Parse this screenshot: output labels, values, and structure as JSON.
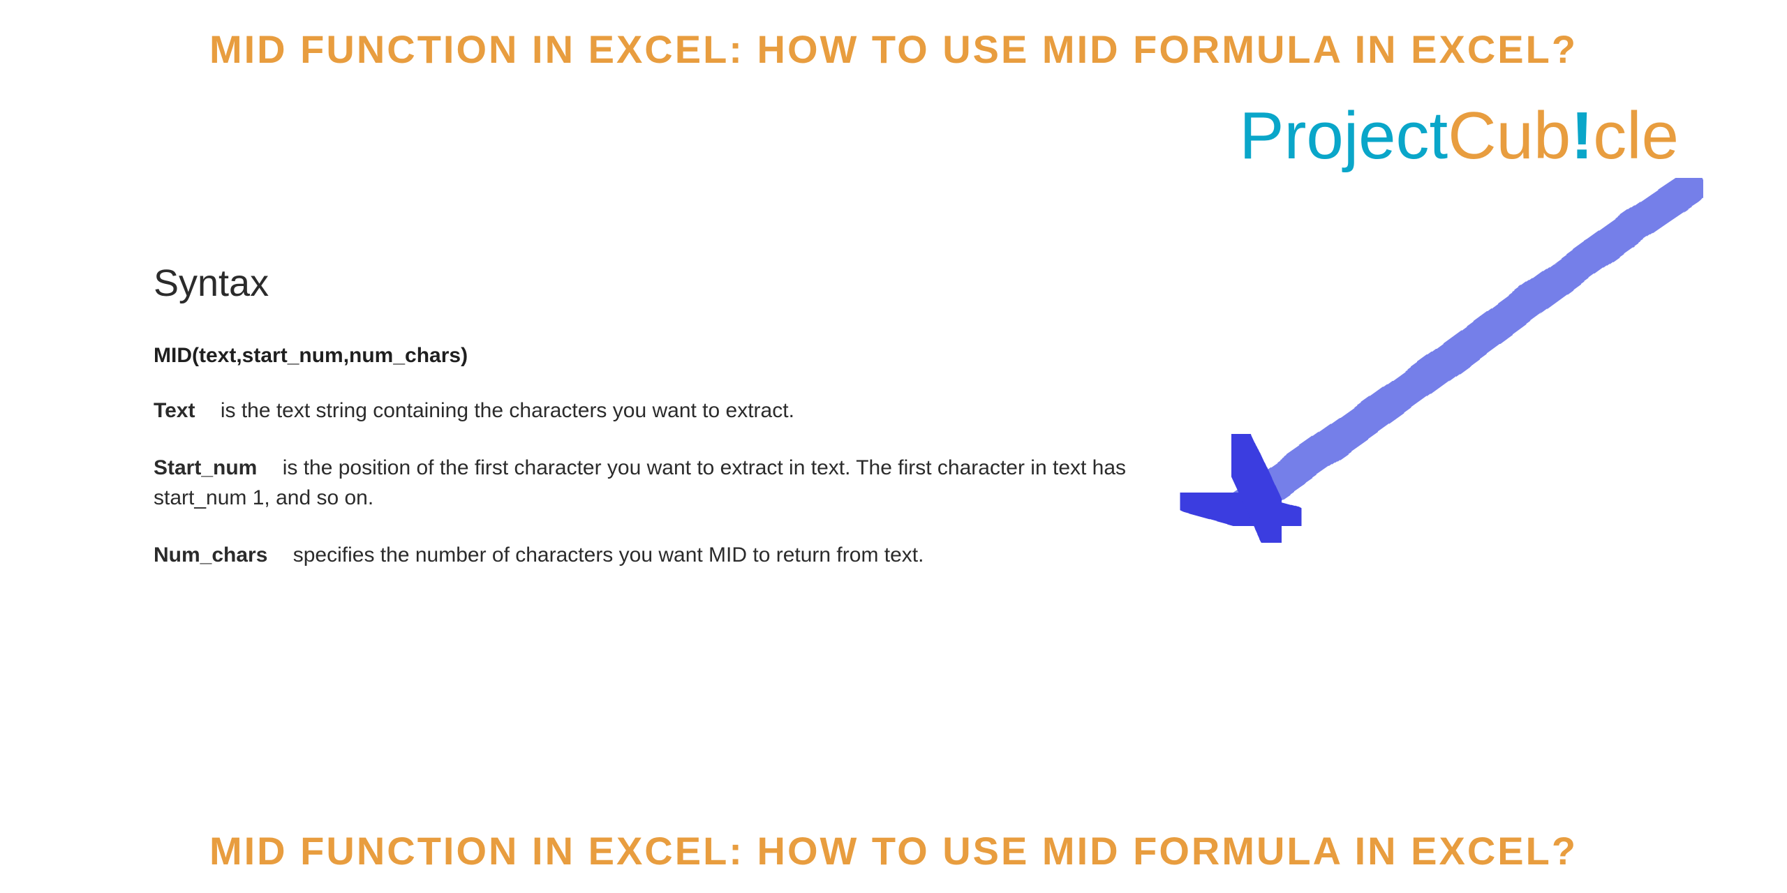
{
  "title_top": "MID FUNCTION IN EXCEL: HOW TO USE MID FORMULA IN EXCEL?",
  "title_bottom": "MID FUNCTION IN EXCEL: HOW TO USE MID FORMULA IN EXCEL?",
  "logo": {
    "part1": "Project",
    "part2": "Cub",
    "excl": "!",
    "part3": "cle"
  },
  "content": {
    "heading": "Syntax",
    "formula": "MID(text,start_num,num_chars)",
    "params": [
      {
        "name": "Text",
        "desc": "is the text string containing the characters you want to extract."
      },
      {
        "name": "Start_num",
        "desc": "is the position of the first character you want to extract in text. The first character in text has start_num 1, and so on."
      },
      {
        "name": "Num_chars",
        "desc": "specifies the number of characters you want MID to return from text."
      }
    ]
  }
}
